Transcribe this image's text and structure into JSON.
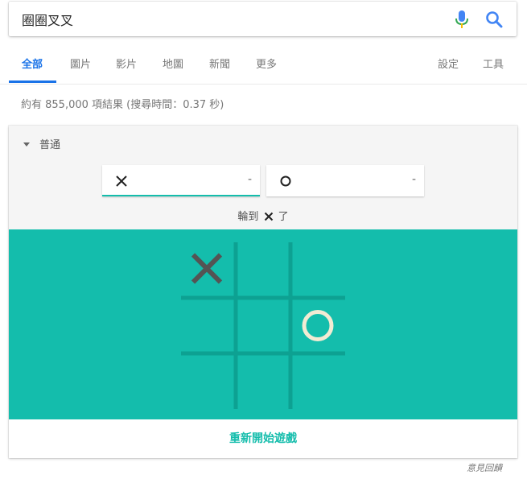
{
  "search": {
    "query": "圈圈叉叉"
  },
  "tabs": [
    {
      "label": "全部",
      "active": true
    },
    {
      "label": "圖片"
    },
    {
      "label": "影片"
    },
    {
      "label": "地圖"
    },
    {
      "label": "新聞"
    },
    {
      "label": "更多"
    }
  ],
  "tools": {
    "settings": "設定",
    "tools": "工具"
  },
  "result_stats": "約有 855,000 項結果 (搜尋時間：0.37 秒)",
  "game": {
    "difficulty": "普通",
    "score_x": "-",
    "score_o": "-",
    "turn_prefix": "輪到",
    "turn_suffix": "了",
    "restart_label": "重新開始遊戲",
    "board": [
      [
        "X",
        "",
        ""
      ],
      [
        "",
        "",
        "O"
      ],
      [
        "",
        "",
        ""
      ]
    ]
  },
  "colors": {
    "accent": "#14bdac",
    "blue": "#1a73e8",
    "x_mark": "#545454",
    "o_mark": "#f2ebd3",
    "grid": "#0da192"
  },
  "feedback": "意見回饋"
}
